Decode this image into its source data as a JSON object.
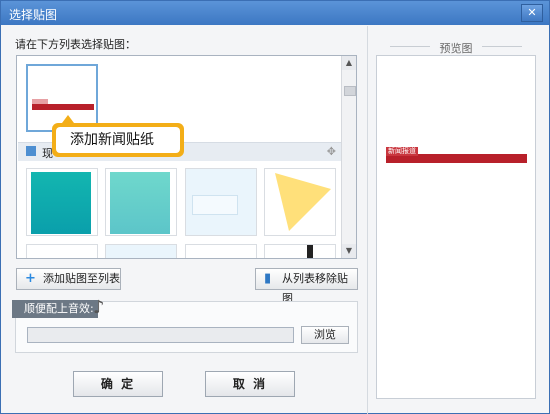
{
  "window": {
    "title": "选择贴图",
    "close_glyph": "✕"
  },
  "list": {
    "label": "请在下方列表选择贴图：",
    "category_label": "现",
    "tooltip": "添加新闻贴纸",
    "move_glyph": "✥"
  },
  "buttons": {
    "add": "添加贴图至列表",
    "add_icon": "plus-icon",
    "remove": "从列表移除贴图",
    "remove_icon": "trash-icon"
  },
  "audio": {
    "label": "顺便配上音效:",
    "value": "",
    "browse": "浏览"
  },
  "footer": {
    "ok": "确 定",
    "cancel": "取 消"
  },
  "preview": {
    "title": "预览图",
    "sticker_text": "新闻报道"
  },
  "colors": {
    "accent": "#f3ae18",
    "red": "#b8202a",
    "teal": "#0aa6a6"
  }
}
